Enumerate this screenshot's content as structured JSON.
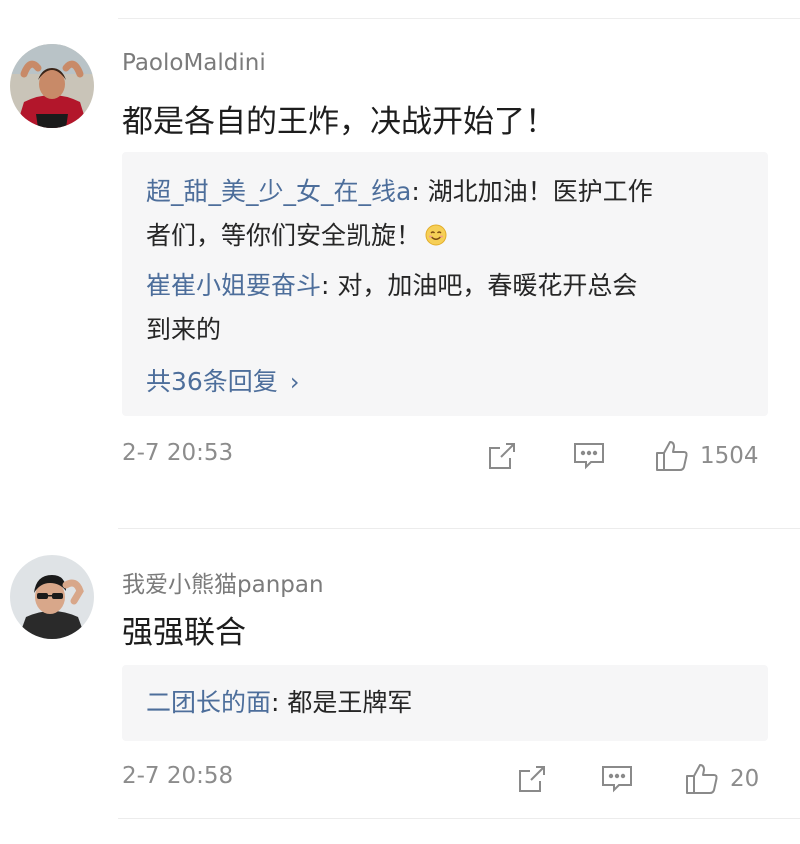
{
  "comments": [
    {
      "username": "PaoloMaldini",
      "text": "都是各自的王炸，决战开始了！",
      "replies": [
        {
          "name": "超_甜_美_少_女_在_线a",
          "text_line1": ": 湖北加油！医护工作",
          "text_line2": "者们，等你们安全凯旋！"
        },
        {
          "name": "崔崔小姐要奋斗",
          "text_line1": ": 对，加油吧，春暖花开总会",
          "text_line2": "到来的"
        }
      ],
      "more_replies": "共36条回复",
      "time": "2-7 20:53",
      "likes": "1504",
      "icons": {
        "share": "share-icon",
        "reply": "comment-icon",
        "like": "thumbs-up-icon",
        "emoji": "smile-emoji-icon"
      }
    },
    {
      "username": "我爱小熊猫panpan",
      "text": "强强联合",
      "replies": [
        {
          "name": "二团长的面",
          "text_line1": ": 都是王牌军"
        }
      ],
      "time": "2-7 20:58",
      "likes": "20",
      "icons": {
        "share": "share-icon",
        "reply": "comment-icon",
        "like": "thumbs-up-icon"
      }
    }
  ],
  "colors": {
    "link": "#4d6e9b",
    "meta": "#8c8c8c",
    "reply_bg": "#f6f6f7"
  }
}
